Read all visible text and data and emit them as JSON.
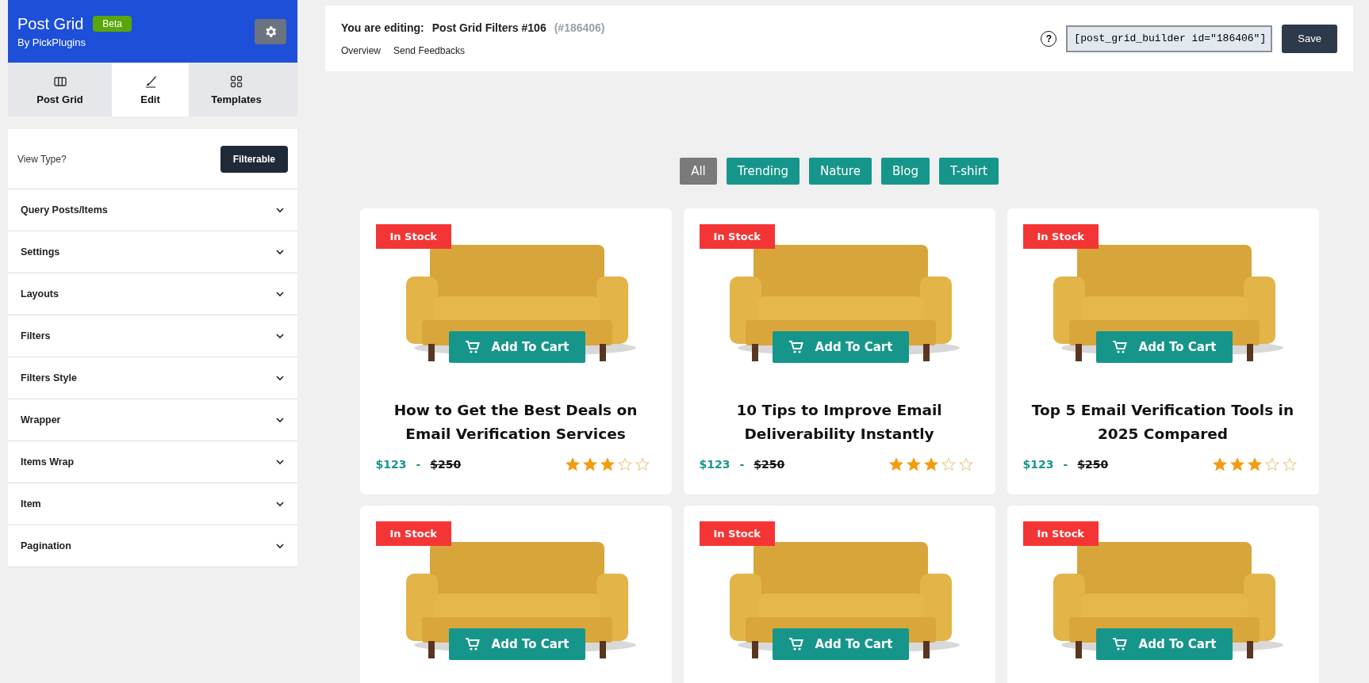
{
  "sidebar": {
    "title": "Post Grid",
    "badge": "Beta",
    "subtitle": "By PickPlugins",
    "tabs": [
      {
        "label": "Post Grid",
        "selected": false
      },
      {
        "label": "Edit",
        "selected": true
      },
      {
        "label": "Templates",
        "selected": false
      }
    ],
    "view_type": {
      "label": "View Type?",
      "value": "Filterable"
    },
    "sections": [
      {
        "label": "Query Posts/Items",
        "expanded": false
      },
      {
        "label": "Settings",
        "expanded": false
      },
      {
        "label": "Layouts",
        "expanded": false
      },
      {
        "label": "Filters",
        "expanded": false
      },
      {
        "label": "Filters Style",
        "expanded": false
      },
      {
        "label": "Wrapper",
        "expanded": false
      },
      {
        "label": "Items Wrap",
        "expanded": false
      },
      {
        "label": "Item",
        "expanded": false
      },
      {
        "label": "Pagination",
        "expanded": false
      }
    ]
  },
  "header": {
    "editing_label": "You are editing:",
    "post_title": "Post Grid Filters #106",
    "post_id": "(#186406)",
    "links": [
      "Overview",
      "Send Feedbacks"
    ],
    "help": "?",
    "shortcode": "[post_grid_builder id=\"186406\"]",
    "save": "Save"
  },
  "filters": [
    {
      "label": "All",
      "selected": true
    },
    {
      "label": "Trending",
      "selected": false
    },
    {
      "label": "Nature",
      "selected": false
    },
    {
      "label": "Blog",
      "selected": false
    },
    {
      "label": "T-shirt",
      "selected": false
    }
  ],
  "cards": [
    {
      "badge": "In Stock",
      "button": "Add To Cart",
      "title": "How to Get the Best Deals on Email Verification Services",
      "price": "$123",
      "separator": "-",
      "old_price": "$250",
      "stars": 3
    },
    {
      "badge": "In Stock",
      "button": "Add To Cart",
      "title": "10 Tips to Improve Email Deliverability Instantly",
      "price": "$123",
      "separator": "-",
      "old_price": "$250",
      "stars": 3
    },
    {
      "badge": "In Stock",
      "button": "Add To Cart",
      "title": "Top 5 Email Verification Tools in 2025 Compared",
      "price": "$123",
      "separator": "-",
      "old_price": "$250",
      "stars": 3
    },
    {
      "badge": "In Stock",
      "button": "Add To Cart"
    },
    {
      "badge": "In Stock",
      "button": "Add To Cart"
    },
    {
      "badge": "In Stock",
      "button": "Add To Cart"
    }
  ]
}
